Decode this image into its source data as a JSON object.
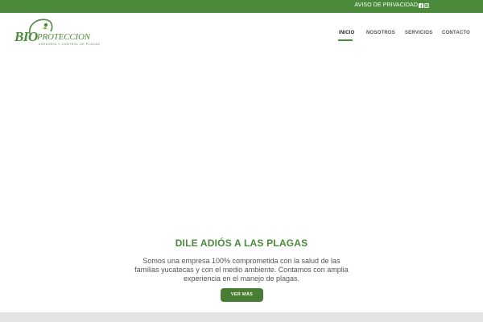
{
  "topbar": {
    "privacy_label": "AVISO DE PRIVACIDAD",
    "social_icons": [
      "facebook-icon",
      "instagram-icon"
    ],
    "background_color": "#4a8a3a"
  },
  "logo": {
    "brand_bio": "BIO",
    "brand_rest": "PROTECCION",
    "tagline": "ASESORIA Y CONTROL DE PLAGAS",
    "color": "#4d8a3c"
  },
  "nav": {
    "items": [
      {
        "label": "INICIO",
        "active": true
      },
      {
        "label": "NOSOTROS",
        "active": false
      },
      {
        "label": "SERVICIOS",
        "active": false
      },
      {
        "label": "CONTACTO",
        "active": false
      }
    ],
    "accent_color": "#4a8a3a"
  },
  "hero": {
    "title": "DILE ADIÓS A LAS PLAGAS",
    "text": "Somos una empresa 100% comprometida con la salud de las familias yucatecas y con el medio ambiente. Contamos con amplia experiencia en el manejo de plagas.",
    "cta_label": "VER MÁS"
  }
}
